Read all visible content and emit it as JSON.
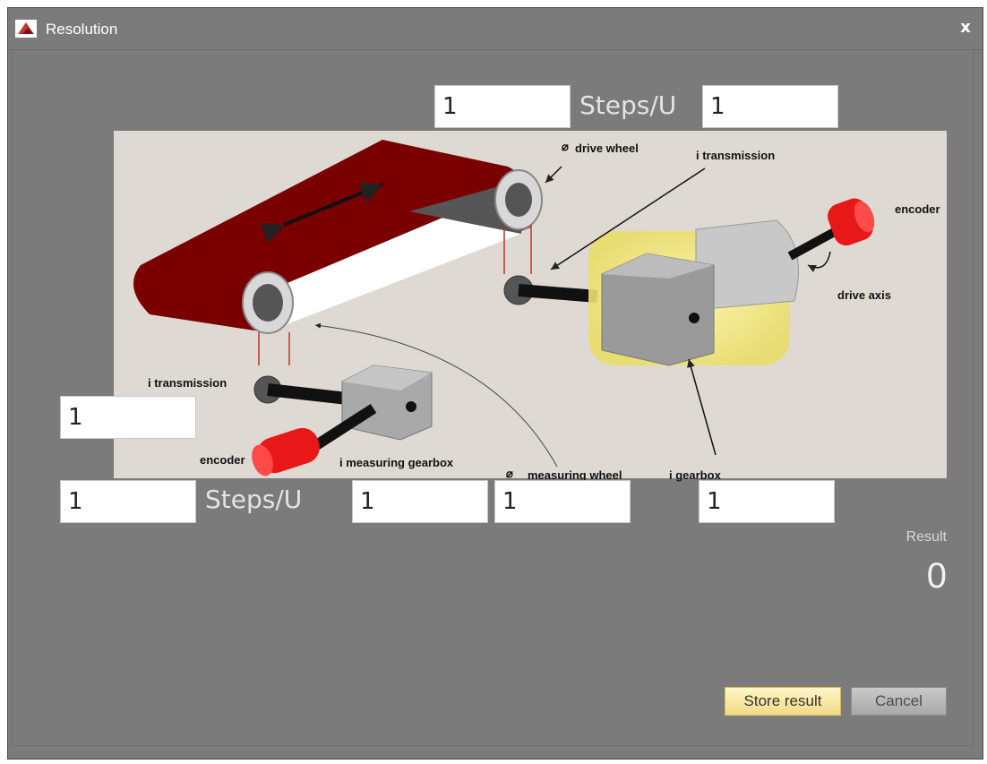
{
  "window": {
    "title": "Resolution",
    "close_label": "x"
  },
  "inputs": {
    "top_steps_left": "1",
    "top_steps_right": "1",
    "left_side": "1",
    "bottom_steps_left": "1",
    "bottom_middle_1": "1",
    "bottom_middle_2": "1",
    "bottom_right": "1"
  },
  "units": {
    "top": "Steps/U",
    "bottom": "Steps/U"
  },
  "diagram": {
    "labels": {
      "drive_wheel": "drive wheel",
      "i_transmission_top": "i transmission",
      "encoder_right": "encoder",
      "drive_axis": "drive axis",
      "i_transmission_left": "i transmission",
      "encoder_left": "encoder",
      "i_measuring_gearbox": "i measuring gearbox",
      "measuring_wheel": "measuring wheel",
      "i_gearbox": "i gearbox"
    },
    "diameter_symbol": "⌀"
  },
  "result": {
    "label": "Result",
    "value": "0"
  },
  "buttons": {
    "store": "Store result",
    "cancel": "Cancel"
  },
  "colors": {
    "belt": "#8b0000",
    "encoder": "#e81818",
    "glow": "#f2ea8a",
    "background": "#7b7b7b"
  }
}
